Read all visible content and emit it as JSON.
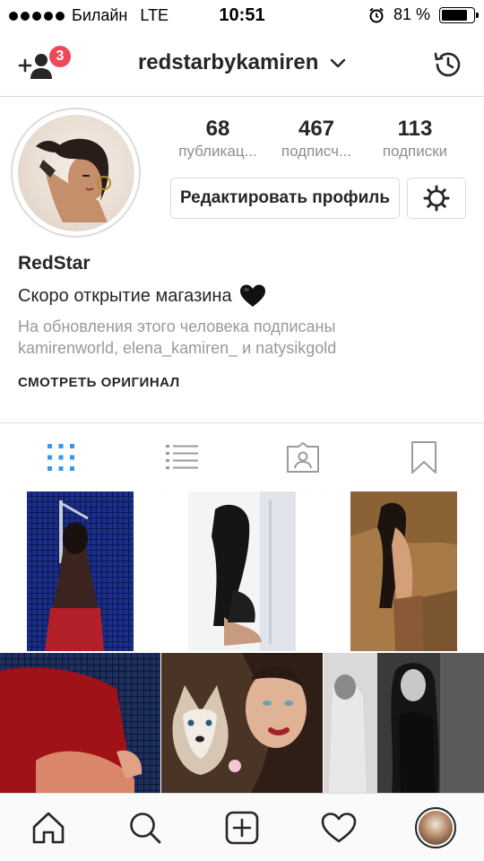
{
  "status_bar": {
    "carrier": "Билайн",
    "network": "LTE",
    "time": "10:51",
    "battery_percent_text": "81 %",
    "battery_level": 0.81,
    "signal_dots": 5
  },
  "top_nav": {
    "username": "redstarbykamiren",
    "notification_count": "3",
    "icons": {
      "add_friends": "add-person-icon",
      "switch_account": "chevron-down-icon",
      "archive": "history-icon"
    }
  },
  "profile": {
    "stats": [
      {
        "value": "68",
        "label": "публикац..."
      },
      {
        "value": "467",
        "label": "подписч..."
      },
      {
        "value": "113",
        "label": "подписки"
      }
    ],
    "edit_button": "Редактировать профиль",
    "full_name": "RedStar",
    "bio": "Скоро открытие магазина",
    "bio_emoji": "black-heart-icon",
    "followed_by": "На обновления этого человека подписаны kamirenworld, elena_kamiren_ и natysikgold",
    "see_original": "СМОТРЕТЬ ОРИГИНАЛ"
  },
  "tabs": [
    {
      "icon": "grid-icon",
      "active": true
    },
    {
      "icon": "list-icon",
      "active": false
    },
    {
      "icon": "tagged-icon",
      "active": false
    },
    {
      "icon": "bookmark-icon",
      "active": false
    }
  ],
  "posts": [
    {
      "alt": "photo-blue-tiles",
      "palette": [
        "#0d1a4a",
        "#1f3a9a",
        "#b3202a"
      ]
    },
    {
      "alt": "photo-window-light",
      "palette": [
        "#f4f6f8",
        "#d8dde3",
        "#1a1a1a"
      ]
    },
    {
      "alt": "photo-stone-wall",
      "palette": [
        "#b98a52",
        "#8a6236",
        "#2a1a12"
      ]
    },
    {
      "alt": "photo-red-dress-tiles",
      "palette": [
        "#13203a",
        "#a8141c",
        "#e06a4a"
      ]
    },
    {
      "alt": "photo-puppy",
      "palette": [
        "#5a4030",
        "#e9e2d8",
        "#b04a3a"
      ]
    },
    {
      "alt": "photo-bw-street",
      "palette": [
        "#e8e8e8",
        "#6a6a6a",
        "#111111"
      ]
    }
  ],
  "bottom_nav": [
    "home-icon",
    "search-icon",
    "new-post-icon",
    "activity-icon",
    "profile-avatar"
  ],
  "colors": {
    "accent_blue": "#3897f0",
    "badge_red": "#ed4956",
    "text": "#262626",
    "muted": "#8e8e8e"
  }
}
